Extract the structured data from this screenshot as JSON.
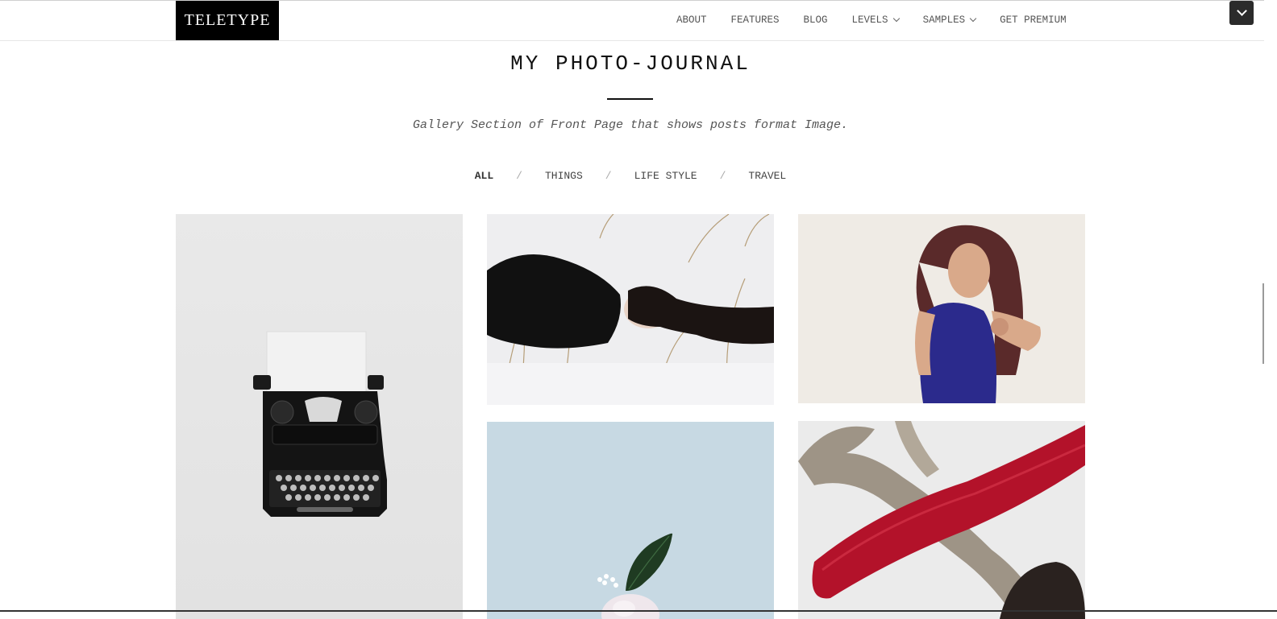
{
  "header": {
    "logo": "TELETYPE",
    "nav": [
      {
        "label": "ABOUT",
        "dropdown": false
      },
      {
        "label": "FEATURES",
        "dropdown": false
      },
      {
        "label": "BLOG",
        "dropdown": false
      },
      {
        "label": "LEVELS",
        "dropdown": true
      },
      {
        "label": "SAMPLES",
        "dropdown": true
      },
      {
        "label": "GET PREMIUM",
        "dropdown": false
      }
    ],
    "corner_icon": "chevron-down-icon"
  },
  "section": {
    "title": "MY PHOTO-JOURNAL",
    "subtitle": "Gallery Section of Front Page that shows posts format Image.",
    "filters": [
      "ALL",
      "THINGS",
      "LIFE STYLE",
      "TRAVEL"
    ],
    "active_filter": "ALL"
  },
  "gallery": [
    {
      "subject": "typewriter"
    },
    {
      "subject": "woman-lying-in-snow"
    },
    {
      "subject": "woman-in-blue-top"
    },
    {
      "subject": "leaf-and-flower-on-blue"
    },
    {
      "subject": "antler-with-red-paint"
    }
  ],
  "colors": {
    "accent": "#000000",
    "text": "#555555"
  }
}
